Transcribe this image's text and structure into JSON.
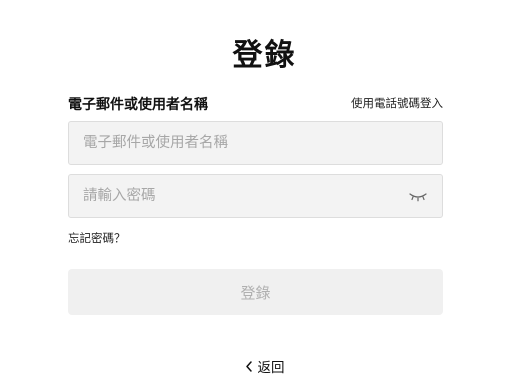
{
  "page": {
    "title": "登錄"
  },
  "form": {
    "email_label": "電子郵件或使用者名稱",
    "phone_login_link": "使用電話號碼登入",
    "email_placeholder": "電子郵件或使用者名稱",
    "password_placeholder": "請輸入密碼",
    "password_toggle_icon": "eye-closed-icon",
    "forgot_password": "忘記密碼？",
    "submit_label": "登錄"
  },
  "footer": {
    "back_icon": "chevron-left-icon",
    "back_label": "返回"
  },
  "colors": {
    "input_background": "#f3f3f3",
    "button_background": "#f0f0f0",
    "button_text_disabled": "#b0b0b0",
    "placeholder": "#a7a7a7"
  }
}
